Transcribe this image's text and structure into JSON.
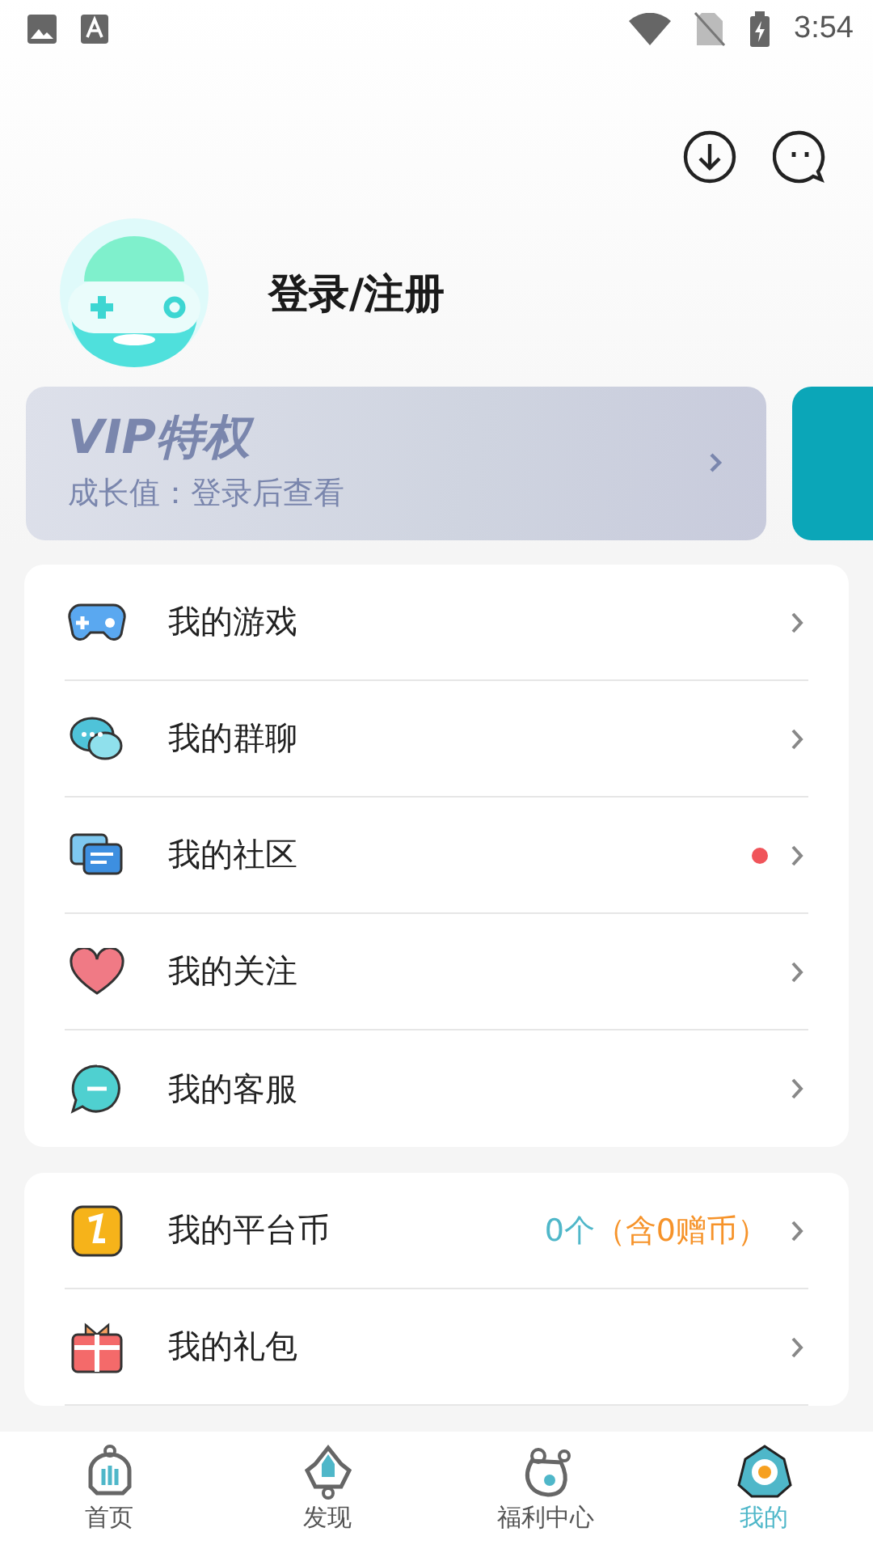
{
  "status_bar": {
    "time": "3:54"
  },
  "profile": {
    "name": "登录/注册"
  },
  "vip_card": {
    "title": "VIP特权",
    "subtitle": "成长值：登录后查看"
  },
  "menu_groups": [
    {
      "items": [
        {
          "label": "我的游戏",
          "badge_dot": false
        },
        {
          "label": "我的群聊",
          "badge_dot": false
        },
        {
          "label": "我的社区",
          "badge_dot": true
        },
        {
          "label": "我的关注",
          "badge_dot": false
        },
        {
          "label": "我的客服",
          "badge_dot": false
        }
      ]
    },
    {
      "items": [
        {
          "label": "我的平台币",
          "badge_dot": false,
          "value": "0个",
          "value_note": "（含0赠币）"
        },
        {
          "label": "我的礼包",
          "badge_dot": false
        }
      ]
    }
  ],
  "bottom_nav": [
    {
      "label": "首页",
      "selected": false
    },
    {
      "label": "发现",
      "selected": false
    },
    {
      "label": "福利中心",
      "selected": false
    },
    {
      "label": "我的",
      "selected": true
    }
  ]
}
